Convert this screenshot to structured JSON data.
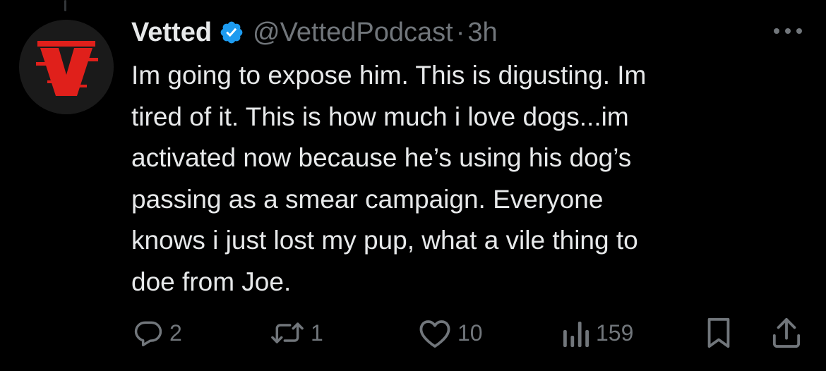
{
  "tweet": {
    "display_name": "Vetted",
    "handle": "@VettedPodcast",
    "separator": "·",
    "time": "3h",
    "text_lines": [
      "Im going to expose him. This is digusting. Im",
      "tired of it. This is how much i love dogs...im",
      "activated now because he’s using his dog’s",
      "passing as a smear campaign. Everyone",
      "knows i just lost my pup, what a vile thing to",
      "doe from Joe."
    ],
    "avatar_letter": "V"
  },
  "actions": {
    "replies": "2",
    "reposts": "1",
    "likes": "10",
    "views": "159"
  },
  "icons": {
    "verified": "verified-badge-icon",
    "more": "more-options-icon",
    "reply": "reply-icon",
    "repost": "repost-icon",
    "like": "like-icon",
    "views": "views-icon",
    "bookmark": "bookmark-icon",
    "share": "share-icon"
  },
  "colors": {
    "background": "#000000",
    "text": "#e7e9ea",
    "muted": "#71767b",
    "verified": "#1d9bf0",
    "avatar_accent": "#e0201b"
  }
}
